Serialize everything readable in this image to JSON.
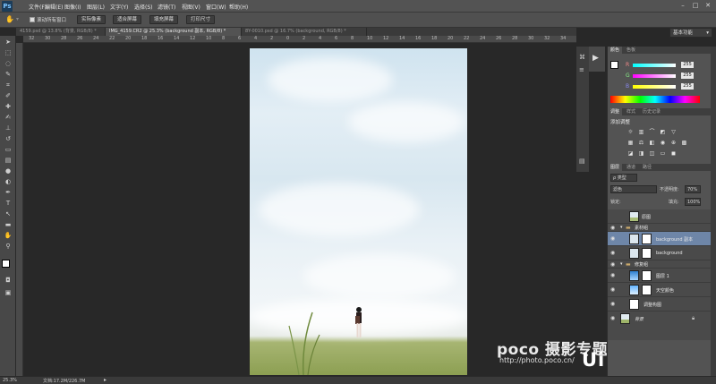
{
  "app": {
    "logo": "Ps"
  },
  "menu": [
    "文件(F)",
    "编辑(E)",
    "图像(I)",
    "图层(L)",
    "文字(Y)",
    "选择(S)",
    "滤镜(T)",
    "视图(V)",
    "窗口(W)",
    "帮助(H)"
  ],
  "window_controls": {
    "minimize": "–",
    "maximize": "□",
    "close": "✕"
  },
  "options": {
    "check_label": "滚动所有窗口",
    "buttons": [
      "实际像素",
      "适合屏幕",
      "填充屏幕",
      "打印尺寸"
    ],
    "workspace": "基本功能"
  },
  "tabs": [
    {
      "label": "4159.psd @ 13.8% (背景, RGB/8) *",
      "active": false
    },
    {
      "label": "IMG_4159.CR2 @ 25.3% (background 副本, RGB/8) *",
      "active": true
    },
    {
      "label": "8Y-0010.psd @ 16.7% (background, RGB/8) *",
      "active": false
    }
  ],
  "ruler_ticks": [
    "32",
    "30",
    "28",
    "26",
    "24",
    "22",
    "20",
    "18",
    "16",
    "14",
    "12",
    "10",
    "8",
    "6",
    "4",
    "2",
    "0",
    "2",
    "4",
    "6",
    "8",
    "10",
    "12",
    "14",
    "16",
    "18",
    "20",
    "22",
    "24",
    "26",
    "28",
    "30",
    "32",
    "34"
  ],
  "tools": [
    "move-icon",
    "marquee-icon",
    "lasso-icon",
    "quick-select-icon",
    "crop-icon",
    "eyedropper-icon",
    "healing-icon",
    "brush-icon",
    "stamp-icon",
    "history-brush-icon",
    "eraser-icon",
    "gradient-icon",
    "blur-icon",
    "dodge-icon",
    "pen-icon",
    "type-icon",
    "path-select-icon",
    "shape-icon",
    "hand-icon",
    "zoom-icon"
  ],
  "color_panel": {
    "tabs": [
      "颜色",
      "色板"
    ],
    "r_label": "R",
    "g_label": "G",
    "b_label": "B",
    "r": "255",
    "g": "255",
    "b": "255"
  },
  "adjust_panel": {
    "tabs": [
      "调整",
      "样式",
      "历史记录"
    ],
    "title": "添加调整"
  },
  "layers_panel": {
    "tabs": [
      "图层",
      "通道",
      "路径"
    ],
    "filter": "ρ 类型",
    "blend_mode": "滤色",
    "opacity_label": "不透明度:",
    "opacity": "70%",
    "lock_label": "锁定:",
    "fill_label": "填充:",
    "fill": "100%",
    "layers": [
      {
        "name": "原图",
        "type": "layer",
        "visible": false,
        "selected": false,
        "thumb": "#a9bd78"
      },
      {
        "name": "素材组",
        "type": "group",
        "visible": true,
        "selected": false
      },
      {
        "name": "background 副本",
        "type": "layer",
        "visible": true,
        "selected": true,
        "thumb": "#dbe6ee"
      },
      {
        "name": "background",
        "type": "layer",
        "visible": true,
        "selected": false,
        "thumb": "#dbe6ee"
      },
      {
        "name": "修复组",
        "type": "group",
        "visible": true,
        "selected": false
      },
      {
        "name": "图层 1",
        "type": "layer",
        "visible": true,
        "selected": false,
        "thumb": "#5aa0e0"
      },
      {
        "name": "天空颜色",
        "type": "layer",
        "visible": true,
        "selected": false,
        "thumb": "#7fc2ff"
      },
      {
        "name": "调整构图",
        "type": "layer",
        "visible": true,
        "selected": false,
        "thumb": "#ffffff"
      },
      {
        "name": "背景",
        "type": "layer",
        "visible": true,
        "selected": false,
        "thumb": "#9fb56a"
      }
    ]
  },
  "status": {
    "zoom": "25.3%",
    "doc": "文档:17.2M/226.7M"
  },
  "watermark": {
    "brand": "poco 摄影专题",
    "url": "http://photo.poco.cn/",
    "site": "UiBQ.CoM"
  }
}
